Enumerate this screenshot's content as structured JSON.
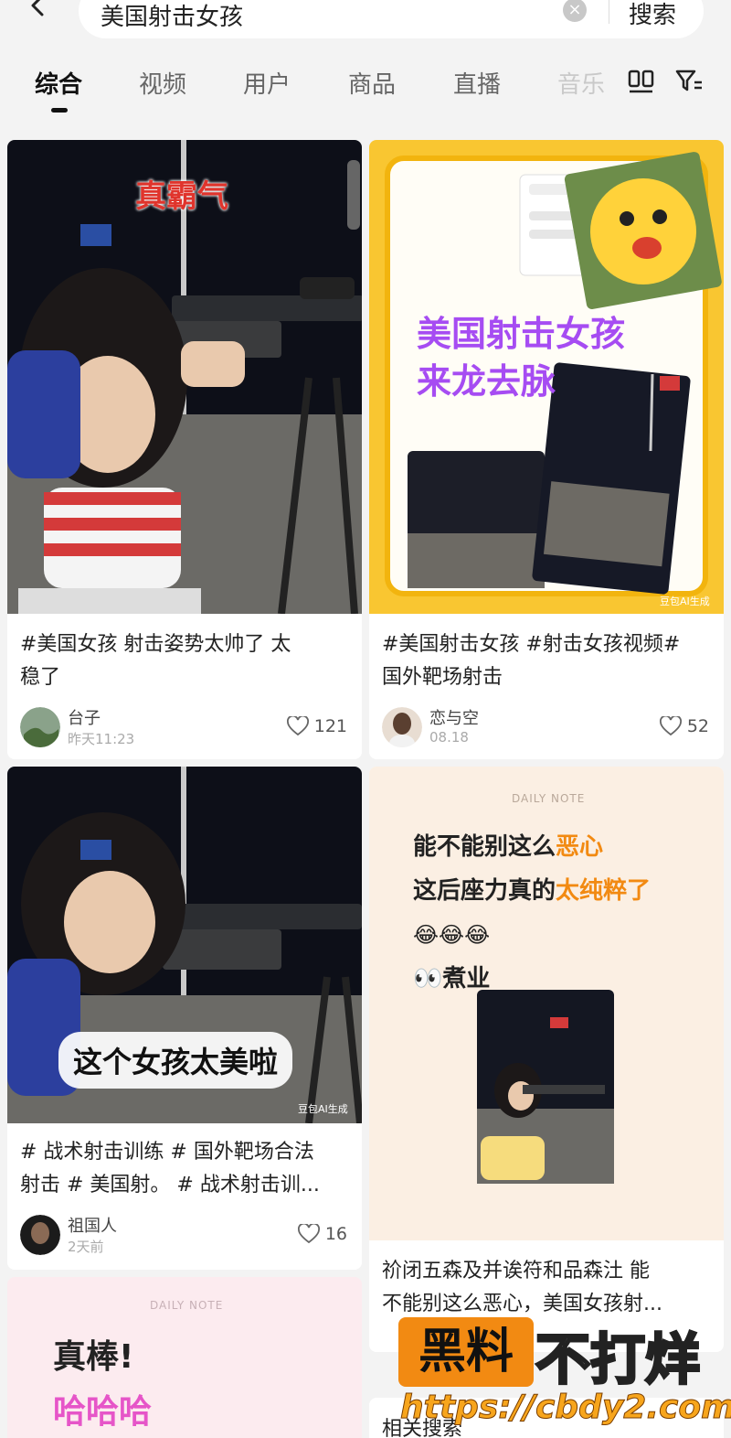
{
  "header": {
    "search_query": "美国射击女孩",
    "clear_symbol": "×",
    "search_button": "搜索"
  },
  "tabs": [
    {
      "label": "综合",
      "active": true
    },
    {
      "label": "视频",
      "active": false
    },
    {
      "label": "用户",
      "active": false
    },
    {
      "label": "商品",
      "active": false
    },
    {
      "label": "直播",
      "active": false
    },
    {
      "label": "音乐",
      "active": false
    }
  ],
  "icons": {
    "back": "chevron-left-icon",
    "layout": "double-column-layout-icon",
    "filter": "filter-icon",
    "like": "heart-outline-icon"
  },
  "colors": {
    "accent_purple": "#a64cf2",
    "accent_orange": "#f28a12",
    "card_yellow": "#f9c631",
    "overlay_red": "#e0342c"
  },
  "feed": {
    "card1": {
      "overlay": "真霸气",
      "caption_line1": "#美国女孩  射击姿势太帅了  太",
      "caption_line2": "稳了",
      "author": "台子",
      "time": "昨天11:23",
      "likes": "121"
    },
    "card2": {
      "title_line1": "美国射击女孩",
      "title_line2": "来龙去脉",
      "ai_tag": "豆包AI生成",
      "caption_line1": "#美国射击女孩 #射击女孩视频#",
      "caption_line2": "国外靶场射击",
      "author": "恋与空",
      "time": "08.18",
      "likes": "52"
    },
    "card3": {
      "overlay": "这个女孩太美啦",
      "ai_tag": "豆包AI生成",
      "caption_line1": "# 战术射击训练 # 国外靶场合法",
      "caption_line2": "射击 # 美国射。 # 战术射击训...",
      "author": "祖国人",
      "time": "2天前",
      "likes": "16"
    },
    "card4": {
      "note_header": "DAILY NOTE",
      "line1_a": "能不能别这么",
      "line1_b": "恶心",
      "line2_a": "这后座力真的",
      "line2_b": "太纯粹了",
      "emoji_row": "😂😂😂",
      "line4": "👀煮业",
      "caption_line1": "祄闭五森及并诶符和品森汢 能",
      "caption_line2": "不能别这么恶心，美国女孩射..."
    },
    "card5": {
      "note_header": "DAILY NOTE",
      "line1": "真棒!",
      "line2": "哈哈哈"
    },
    "bottom_partial": "相关搜索"
  },
  "watermark": {
    "box_text": "黑料",
    "right_text": "不打烊",
    "url": "https://cbdy2.com"
  }
}
